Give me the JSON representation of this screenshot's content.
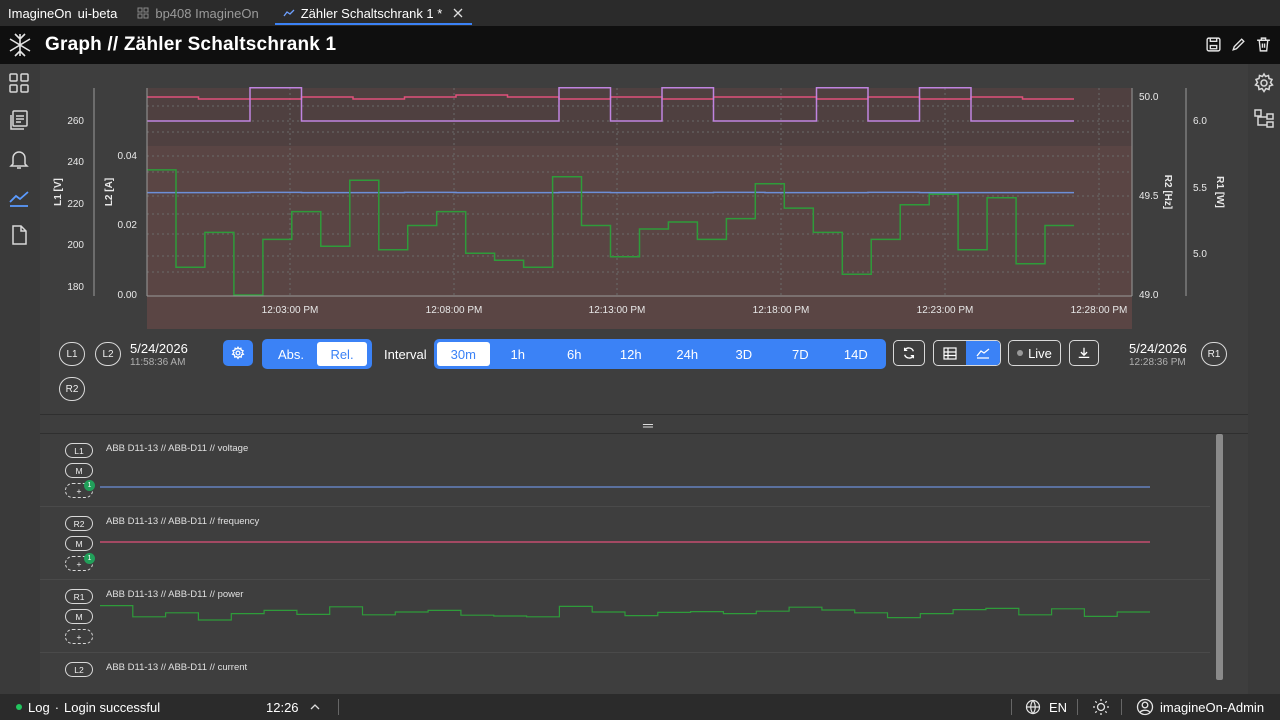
{
  "tabs": {
    "brand": "ImagineOn",
    "brand_suffix": "ui-beta",
    "items": [
      {
        "label": "bp408 ImagineOn",
        "icon": "grid-icon"
      },
      {
        "label": "Zähler Schaltschrank 1 *",
        "icon": "chart-icon"
      }
    ]
  },
  "header": {
    "title": "Graph // Zähler Schaltschrank 1"
  },
  "chart_data": {
    "type": "line",
    "x": [
      "12:03:00 PM",
      "12:08:00 PM",
      "12:13:00 PM",
      "12:18:00 PM",
      "12:23:00 PM",
      "12:28:00 PM"
    ],
    "axes": {
      "L1": {
        "label": "L1 [V]",
        "ticks": [
          "260",
          "240",
          "220",
          "200",
          "180"
        ]
      },
      "L2": {
        "label": "L2 [A]",
        "ticks": [
          "0.04",
          "0.02",
          "0.00"
        ]
      },
      "R2": {
        "label": "R2 [Hz]",
        "ticks": [
          "50.0",
          "49.5",
          "49.0"
        ]
      },
      "R1": {
        "label": "R1 [W]",
        "ticks": [
          "6.0",
          "5.5",
          "5.0"
        ]
      }
    },
    "series": [
      {
        "values": [
          225.5,
          225.5,
          225.6,
          225.5,
          225.5,
          225.6,
          225.5,
          225.5,
          225.6,
          225.5,
          225.5,
          225.6,
          225.5,
          225.5,
          225.6,
          225.5,
          225.5,
          225.5
        ],
        "color": "#6c8fd8"
      },
      {
        "values": [
          50.0,
          49.99,
          49.99,
          50.0,
          49.99,
          50.0,
          50.01,
          50.0,
          49.99,
          50.0,
          49.99,
          50.0,
          50.0,
          49.99,
          50.0,
          49.99,
          50.0,
          49.99
        ],
        "color": "#e0507a"
      },
      {
        "values": [
          6.0,
          6.0,
          6.25,
          6.0,
          6.0,
          6.0,
          6.0,
          6.0,
          6.25,
          6.0,
          6.25,
          6.0,
          6.0,
          6.25,
          6.0,
          6.25,
          6.0,
          6.0
        ],
        "color": "#c084e0"
      },
      {
        "values": [
          0.036,
          0.008,
          0.018,
          0.0,
          0.016,
          0.024,
          0.014,
          0.033,
          0.013,
          0.02,
          0.024,
          0.012,
          0.01,
          0.008,
          0.034,
          0.02,
          0.011,
          0.019,
          0.021,
          0.016,
          0.022,
          0.032,
          0.025,
          0.018,
          0.006,
          0.016,
          0.026,
          0.029,
          0.013,
          0.028,
          0.009,
          0.02
        ],
        "color": "#2e9c3a"
      }
    ]
  },
  "controls": {
    "left_tags": [
      "L1",
      "L2",
      "R2"
    ],
    "right_tag": "R1",
    "start_date": "5/24/2026",
    "start_time": "11:58:36 AM",
    "end_date": "5/24/2026",
    "end_time": "12:28:36 PM",
    "mode_abs": "Abs.",
    "mode_rel": "Rel.",
    "interval_label": "Interval",
    "intervals": [
      "30m",
      "1h",
      "6h",
      "12h",
      "24h",
      "3D",
      "7D",
      "14D"
    ],
    "live_label": "Live"
  },
  "traces": [
    {
      "label": "ABB D11-13 // ABB-D11 // voltage",
      "tags": [
        "L1",
        "M",
        "+"
      ],
      "badge": "1",
      "color": "#6c8fd8"
    },
    {
      "label": "ABB D11-13 // ABB-D11 // frequency",
      "tags": [
        "R2",
        "M",
        "+"
      ],
      "badge": "1",
      "color": "#e0507a"
    },
    {
      "label": "ABB D11-13 // ABB-D11 // power",
      "tags": [
        "R1",
        "M",
        "+"
      ],
      "badge": "",
      "color": "#2e9c3a"
    },
    {
      "label": "ABB D11-13 // ABB-D11 // current",
      "tags": [
        "L2",
        "",
        ""
      ],
      "badge": "",
      "color": "#2e9c3a"
    }
  ],
  "statusbar": {
    "log_label": "Log",
    "message": "Login successful",
    "time": "12:26",
    "language": "EN",
    "user": "imagineOn-Admin"
  }
}
